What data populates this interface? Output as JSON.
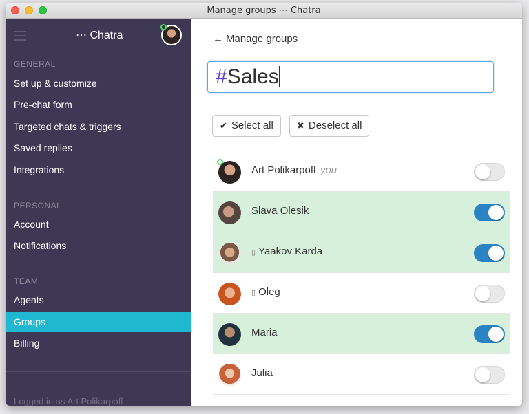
{
  "window": {
    "title": "Manage groups ⋯ Chatra"
  },
  "sidebar": {
    "brand": "⋯ Chatra",
    "sections": [
      {
        "heading": "GENERAL",
        "items": [
          "Set up & customize",
          "Pre-chat form",
          "Targeted chats & triggers",
          "Saved replies",
          "Integrations"
        ]
      },
      {
        "heading": "PERSONAL",
        "items": [
          "Account",
          "Notifications"
        ]
      },
      {
        "heading": "TEAM",
        "items": [
          "Agents",
          "Groups",
          "Billing"
        ]
      }
    ],
    "active_item": "Groups",
    "footer": "Logged in as Art Polikarpoff"
  },
  "main": {
    "back_label": "Manage groups",
    "group_name": {
      "hash": "#",
      "value": "Sales"
    },
    "select_all_label": "Select all",
    "deselect_all_label": "Deselect all",
    "members": [
      {
        "name": "Art Polikarpoff",
        "tag": "you",
        "in_group": false,
        "online": true,
        "mobile": false
      },
      {
        "name": "Slava Olesik",
        "tag": "",
        "in_group": true,
        "online": false,
        "mobile": false
      },
      {
        "name": "Yaakov Karda",
        "tag": "",
        "in_group": true,
        "online": false,
        "mobile": true
      },
      {
        "name": "Oleg",
        "tag": "",
        "in_group": false,
        "online": false,
        "mobile": true
      },
      {
        "name": "Maria",
        "tag": "",
        "in_group": true,
        "online": false,
        "mobile": false
      },
      {
        "name": "Julia",
        "tag": "",
        "in_group": false,
        "online": false,
        "mobile": false
      }
    ]
  },
  "colors": {
    "sidebar_bg": "#3f3854",
    "active_item": "#1fb8d0",
    "member_selected_bg": "#d7f0dc",
    "toggle_on": "#2a84c4",
    "hash": "#5b3fc9"
  },
  "icons": {
    "back": "arrow-left-icon",
    "select_all": "check-icon",
    "deselect_all": "x-icon",
    "mobile": "phone-icon",
    "menu": "hamburger-icon"
  }
}
